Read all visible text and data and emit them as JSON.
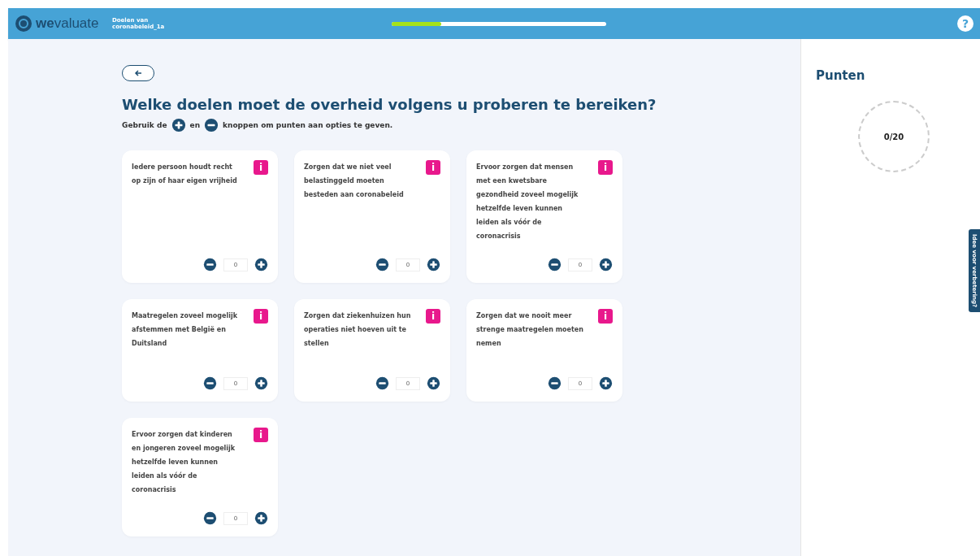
{
  "header": {
    "logo_text_bold": "we",
    "logo_text": "valuate",
    "subtitle_line1": "Doelen van",
    "subtitle_line2": "coronabeleid_1a",
    "progress": {
      "level": 0.23
    },
    "help": "?"
  },
  "question": {
    "title": "Welke doelen moet de overheid volgens u proberen te bereiken?",
    "hint_before": "Gebruik de",
    "hint_middle": "en",
    "hint_after": "knoppen om punten aan opties te geven."
  },
  "options": [
    {
      "text": "Iedere persoon houdt recht op zijn of haar eigen vrijheid",
      "info": "i",
      "value": "0"
    },
    {
      "text": "Zorgen dat we niet veel belastinggeld moeten besteden aan coronabeleid",
      "info": "i",
      "value": "0"
    },
    {
      "text": "Ervoor zorgen dat mensen met een kwetsbare gezondheid zoveel mogelijk hetzelfde leven kunnen leiden als vóór de coronacrisis",
      "info": "i",
      "value": "0"
    },
    {
      "text": "Maatregelen zoveel mogelijk afstemmen met België en Duitsland",
      "info": "i",
      "value": "0"
    },
    {
      "text": "Zorgen dat ziekenhuizen hun operaties niet hoeven uit te stellen",
      "info": "i",
      "value": "0"
    },
    {
      "text": "Zorgen dat we nooit meer strenge maatregelen moeten nemen",
      "info": "i",
      "value": "0"
    },
    {
      "text": "Ervoor zorgen dat kinderen en jongeren zoveel mogelijk hetzelfde leven kunnen leiden als vóór de coronacrisis",
      "info": "i",
      "value": "0"
    }
  ],
  "points": {
    "title": "Punten",
    "value": "0/20"
  },
  "feedback_tab": "Idee voor verbetering?"
}
